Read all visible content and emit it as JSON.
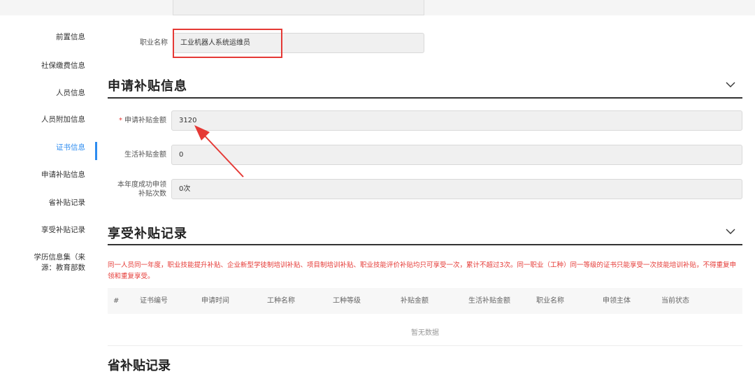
{
  "sidebar": {
    "items": [
      {
        "label": "前置信息"
      },
      {
        "label": "社保缴费信息"
      },
      {
        "label": "人员信息"
      },
      {
        "label": "人员附加信息"
      },
      {
        "label": "证书信息"
      },
      {
        "label": "申请补贴信息"
      },
      {
        "label": "省补贴记录"
      },
      {
        "label": "享受补贴记录"
      },
      {
        "label": "学历信息集（来源：教育部数"
      }
    ],
    "active_index": 4
  },
  "occupation": {
    "label": "职业名称",
    "value": "工业机器人系统运维员"
  },
  "subsidy_section": {
    "title": "申请补贴信息",
    "fields": [
      {
        "label": "申请补贴金额",
        "required": true,
        "value": "3120"
      },
      {
        "label": "生活补贴金额",
        "value": "0"
      },
      {
        "label_line1": "本年度成功申领",
        "label_line2": "补贴次数",
        "value": "0次"
      }
    ]
  },
  "records_section": {
    "title": "享受补贴记录",
    "notice": "同一人员同一年度，职业技能提升补贴、企业新型学徒制培训补贴、项目制培训补贴、职业技能评价补贴均只可享受一次，累计不超过3次。同一职业（工种）同一等级的证书只能享受一次技能培训补贴，不得重复申领和重复享受。",
    "columns": [
      "#",
      "证书编号",
      "申请时间",
      "工种名称",
      "工种等级",
      "补贴金额",
      "生活补贴金额",
      "职业名称",
      "申领主体",
      "当前状态"
    ],
    "empty_text": "暂无数据"
  },
  "next_section": {
    "title": "省补贴记录"
  },
  "colors": {
    "accent": "#2d8cf0",
    "highlight": "#e53935",
    "warning": "#e53935"
  }
}
